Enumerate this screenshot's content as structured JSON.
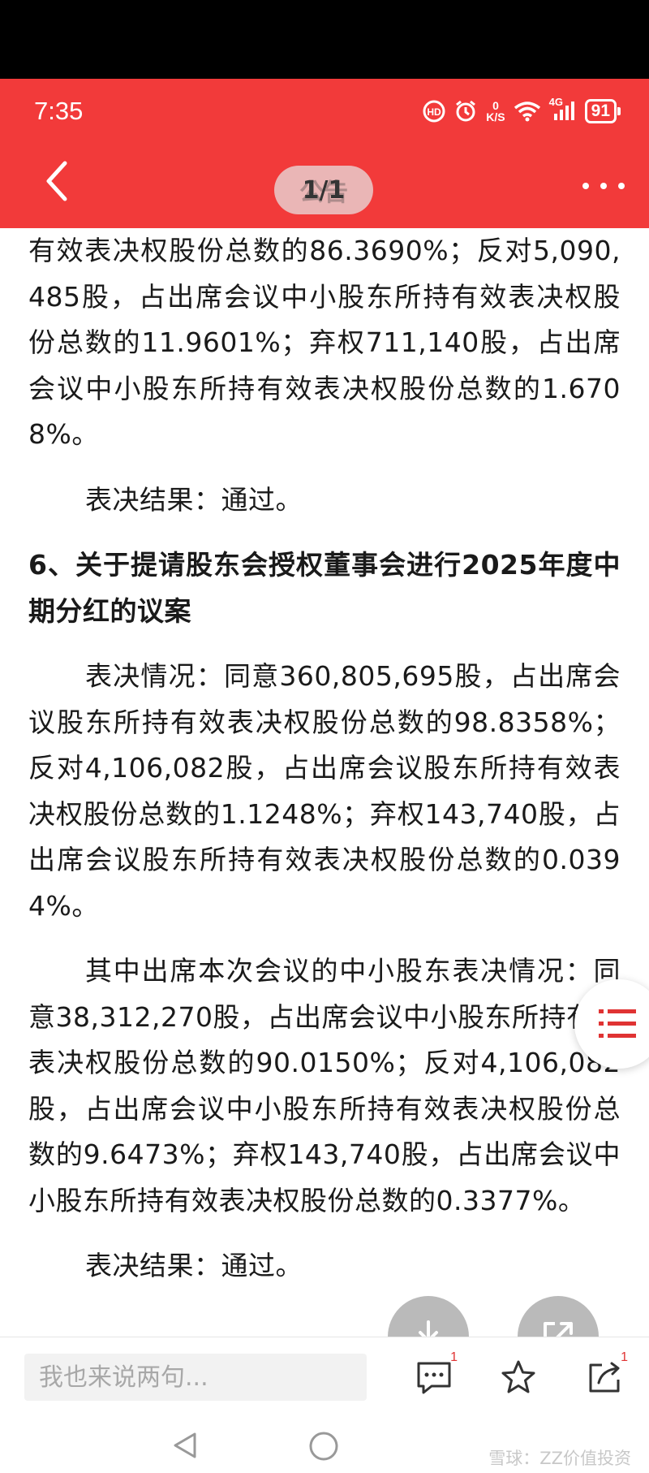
{
  "status_bar": {
    "time": "7:35",
    "network_speed_top": "0",
    "network_speed_unit": "K/S",
    "network_type": "4G",
    "battery": "91"
  },
  "header": {
    "page_indicator": "1/1",
    "pill_overlay_text": "公告"
  },
  "article": {
    "paragraphs": [
      "有效表决权股份总数的86.3690%；反对5,090,485股，占出席会议中小股东所持有效表决权股份总数的11.9601%；弃权711,140股，占出席会议中小股东所持有效表决权股份总数的1.6708%。",
      "表决结果：通过。",
      "6、关于提请股东会授权董事会进行2025年度中期分红的议案",
      "表决情况：同意360,805,695股，占出席会议股东所持有效表决权股份总数的98.8358%；反对4,106,082股，占出席会议股东所持有效表决权股份总数的1.1248%；弃权143,740股，占出席会议股东所持有效表决权股份总数的0.0394%。",
      "其中出席本次会议的中小股东表决情况：同意38,312,270股，占出席会议中小股东所持有效表决权股份总数的90.0150%；反对4,106,082股，占出席会议中小股东所持有效表决权股份总数的9.6473%；弃权143,740股，占出席会议中小股东所持有效表决权股份总数的0.3377%。",
      "表决结果：通过。"
    ]
  },
  "bottom_bar": {
    "comment_placeholder": "我也来说两句...",
    "comment_count": "1",
    "share_count": "1"
  },
  "watermark": "雪球：ZZ价值投资",
  "colors": {
    "header_red": "#f23a3a",
    "fab_gray": "#a0a0a0",
    "list_icon_red": "#e03333"
  },
  "icons": [
    "back-arrow-icon",
    "more-dots-icon",
    "list-icon",
    "download-icon",
    "external-link-icon",
    "comment-icon",
    "star-icon",
    "share-icon",
    "nav-back-icon",
    "nav-home-icon"
  ]
}
